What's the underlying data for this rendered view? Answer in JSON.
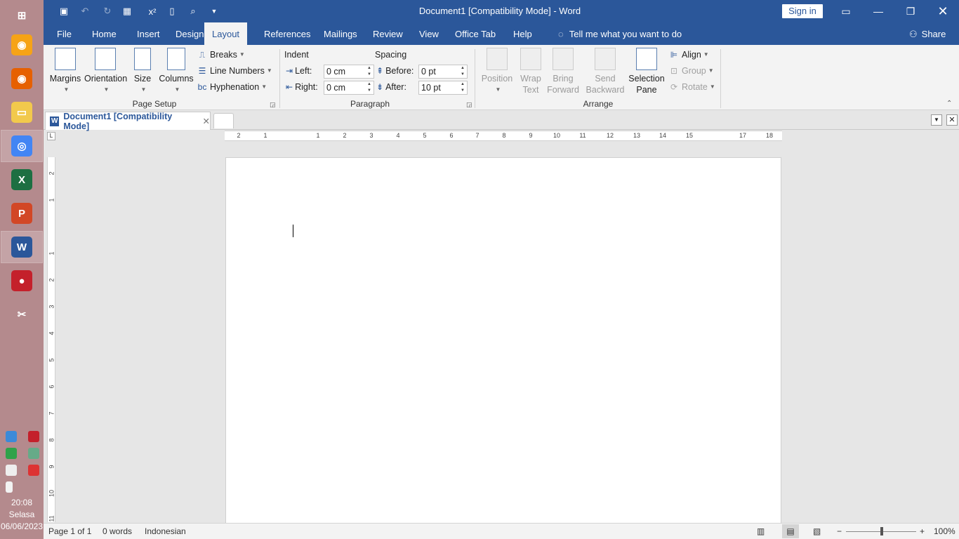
{
  "taskbar": {
    "apps": [
      {
        "name": "windows-start",
        "glyph": "⊞",
        "color": "#b48a8d"
      },
      {
        "name": "firefox-nightly",
        "glyph": "◉",
        "color": "#f6a316"
      },
      {
        "name": "firefox",
        "glyph": "◉",
        "color": "#e66000"
      },
      {
        "name": "file-explorer",
        "glyph": "▭",
        "color": "#f2c94c"
      },
      {
        "name": "chrome",
        "glyph": "◎",
        "color": "#4285f4"
      },
      {
        "name": "excel",
        "glyph": "X",
        "color": "#1d6f42"
      },
      {
        "name": "powerpoint",
        "glyph": "P",
        "color": "#d24726"
      },
      {
        "name": "word",
        "glyph": "W",
        "color": "#2b579a"
      },
      {
        "name": "screen-recorder",
        "glyph": "●",
        "color": "#c4202b"
      },
      {
        "name": "snipping-tool",
        "glyph": "✂",
        "color": "#b48a8d"
      }
    ],
    "clock_time": "20:08",
    "clock_day": "Selasa",
    "clock_date": "06/06/2023"
  },
  "titlebar": {
    "doc_title": "Document1 [Compatibility Mode]  -  Word",
    "sign_in": "Sign in",
    "quick_access": [
      "save",
      "undo",
      "redo",
      "table",
      "superscript",
      "new",
      "print-preview",
      "customize"
    ]
  },
  "tabs": [
    "File",
    "Home",
    "Insert",
    "Design",
    "Layout",
    "References",
    "Mailings",
    "Review",
    "View",
    "Office Tab",
    "Help"
  ],
  "active_tab": "Layout",
  "tell_me": "Tell me what you want to do",
  "share": "Share",
  "ribbon": {
    "page_setup": {
      "label": "Page Setup",
      "margins": "Margins",
      "orientation": "Orientation",
      "size": "Size",
      "columns": "Columns",
      "breaks": "Breaks",
      "line_numbers": "Line Numbers",
      "hyphenation": "Hyphenation"
    },
    "paragraph": {
      "label": "Paragraph",
      "indent": "Indent",
      "spacing": "Spacing",
      "left_label": "Left:",
      "left_value": "0 cm",
      "right_label": "Right:",
      "right_value": "0 cm",
      "before_label": "Before:",
      "before_value": "0 pt",
      "after_label": "After:",
      "after_value": "10 pt"
    },
    "arrange": {
      "label": "Arrange",
      "position": "Position",
      "wrap_text_1": "Wrap",
      "wrap_text_2": "Text",
      "bring_forward_1": "Bring",
      "bring_forward_2": "Forward",
      "send_backward_1": "Send",
      "send_backward_2": "Backward",
      "selection_pane_1": "Selection",
      "selection_pane_2": "Pane",
      "align": "Align",
      "group": "Group",
      "rotate": "Rotate"
    }
  },
  "doc_tab": {
    "title": "Document1 [Compatibility Mode]"
  },
  "ruler": {
    "h_numbers": [
      "2",
      "1",
      "1",
      "2",
      "3",
      "4",
      "5",
      "6",
      "7",
      "8",
      "9",
      "10",
      "11",
      "12",
      "13",
      "14",
      "15",
      "17",
      "18"
    ],
    "v_numbers": [
      "2",
      "1",
      "1",
      "2",
      "3",
      "4",
      "5",
      "6",
      "7",
      "8",
      "9",
      "10",
      "11"
    ]
  },
  "status": {
    "page": "Page 1 of 1",
    "words": "0 words",
    "language": "Indonesian",
    "zoom": "100%"
  }
}
